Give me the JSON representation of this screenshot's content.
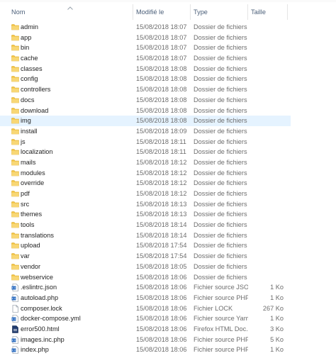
{
  "columns": {
    "name": "Nom",
    "modified": "Modifié le",
    "type": "Type",
    "size": "Taille"
  },
  "files": [
    {
      "name": "admin",
      "date": "15/08/2018 18:07",
      "type": "Dossier de fichiers",
      "size": "",
      "icon": "folder-icon"
    },
    {
      "name": "app",
      "date": "15/08/2018 18:07",
      "type": "Dossier de fichiers",
      "size": "",
      "icon": "folder-icon"
    },
    {
      "name": "bin",
      "date": "15/08/2018 18:07",
      "type": "Dossier de fichiers",
      "size": "",
      "icon": "folder-icon"
    },
    {
      "name": "cache",
      "date": "15/08/2018 18:07",
      "type": "Dossier de fichiers",
      "size": "",
      "icon": "folder-icon"
    },
    {
      "name": "classes",
      "date": "15/08/2018 18:08",
      "type": "Dossier de fichiers",
      "size": "",
      "icon": "folder-icon"
    },
    {
      "name": "config",
      "date": "15/08/2018 18:08",
      "type": "Dossier de fichiers",
      "size": "",
      "icon": "folder-icon"
    },
    {
      "name": "controllers",
      "date": "15/08/2018 18:08",
      "type": "Dossier de fichiers",
      "size": "",
      "icon": "folder-icon"
    },
    {
      "name": "docs",
      "date": "15/08/2018 18:08",
      "type": "Dossier de fichiers",
      "size": "",
      "icon": "folder-icon"
    },
    {
      "name": "download",
      "date": "15/08/2018 18:08",
      "type": "Dossier de fichiers",
      "size": "",
      "icon": "folder-icon"
    },
    {
      "name": "img",
      "date": "15/08/2018 18:08",
      "type": "Dossier de fichiers",
      "size": "",
      "icon": "folder-icon",
      "selected": true
    },
    {
      "name": "install",
      "date": "15/08/2018 18:09",
      "type": "Dossier de fichiers",
      "size": "",
      "icon": "folder-icon"
    },
    {
      "name": "js",
      "date": "15/08/2018 18:11",
      "type": "Dossier de fichiers",
      "size": "",
      "icon": "folder-icon"
    },
    {
      "name": "localization",
      "date": "15/08/2018 18:11",
      "type": "Dossier de fichiers",
      "size": "",
      "icon": "folder-icon"
    },
    {
      "name": "mails",
      "date": "15/08/2018 18:12",
      "type": "Dossier de fichiers",
      "size": "",
      "icon": "folder-icon"
    },
    {
      "name": "modules",
      "date": "15/08/2018 18:12",
      "type": "Dossier de fichiers",
      "size": "",
      "icon": "folder-icon"
    },
    {
      "name": "override",
      "date": "15/08/2018 18:12",
      "type": "Dossier de fichiers",
      "size": "",
      "icon": "folder-icon"
    },
    {
      "name": "pdf",
      "date": "15/08/2018 18:12",
      "type": "Dossier de fichiers",
      "size": "",
      "icon": "folder-icon"
    },
    {
      "name": "src",
      "date": "15/08/2018 18:13",
      "type": "Dossier de fichiers",
      "size": "",
      "icon": "folder-icon"
    },
    {
      "name": "themes",
      "date": "15/08/2018 18:13",
      "type": "Dossier de fichiers",
      "size": "",
      "icon": "folder-icon"
    },
    {
      "name": "tools",
      "date": "15/08/2018 18:14",
      "type": "Dossier de fichiers",
      "size": "",
      "icon": "folder-icon"
    },
    {
      "name": "translations",
      "date": "15/08/2018 18:14",
      "type": "Dossier de fichiers",
      "size": "",
      "icon": "folder-icon"
    },
    {
      "name": "upload",
      "date": "15/08/2018 17:54",
      "type": "Dossier de fichiers",
      "size": "",
      "icon": "folder-icon"
    },
    {
      "name": "var",
      "date": "15/08/2018 17:54",
      "type": "Dossier de fichiers",
      "size": "",
      "icon": "folder-icon"
    },
    {
      "name": "vendor",
      "date": "15/08/2018 18:05",
      "type": "Dossier de fichiers",
      "size": "",
      "icon": "folder-icon"
    },
    {
      "name": "webservice",
      "date": "15/08/2018 18:06",
      "type": "Dossier de fichiers",
      "size": "",
      "icon": "folder-icon"
    },
    {
      "name": ".eslintrc.json",
      "date": "15/08/2018 18:06",
      "type": "Fichier source JSON",
      "size": "1 Ko",
      "icon": "code-file-icon"
    },
    {
      "name": "autoload.php",
      "date": "15/08/2018 18:06",
      "type": "Fichier source PHP",
      "size": "1 Ko",
      "icon": "code-file-icon"
    },
    {
      "name": "composer.lock",
      "date": "15/08/2018 18:06",
      "type": "Fichier LOCK",
      "size": "267 Ko",
      "icon": "blank-file-icon"
    },
    {
      "name": "docker-compose.yml",
      "date": "15/08/2018 18:06",
      "type": "Fichier source Yaml",
      "size": "1 Ko",
      "icon": "code-file-icon"
    },
    {
      "name": "error500.html",
      "date": "15/08/2018 18:06",
      "type": "Firefox HTML Doc...",
      "size": "3 Ko",
      "icon": "html-file-icon"
    },
    {
      "name": "images.inc.php",
      "date": "15/08/2018 18:06",
      "type": "Fichier source PHP",
      "size": "5 Ko",
      "icon": "code-file-icon"
    },
    {
      "name": "index.php",
      "date": "15/08/2018 18:06",
      "type": "Fichier source PHP",
      "size": "1 Ko",
      "icon": "code-file-icon"
    }
  ],
  "colors": {
    "folder": "#f3c442",
    "selection": "#e5f3ff",
    "header_text": "#4c607a",
    "secondary_text": "#6d6d6d"
  }
}
